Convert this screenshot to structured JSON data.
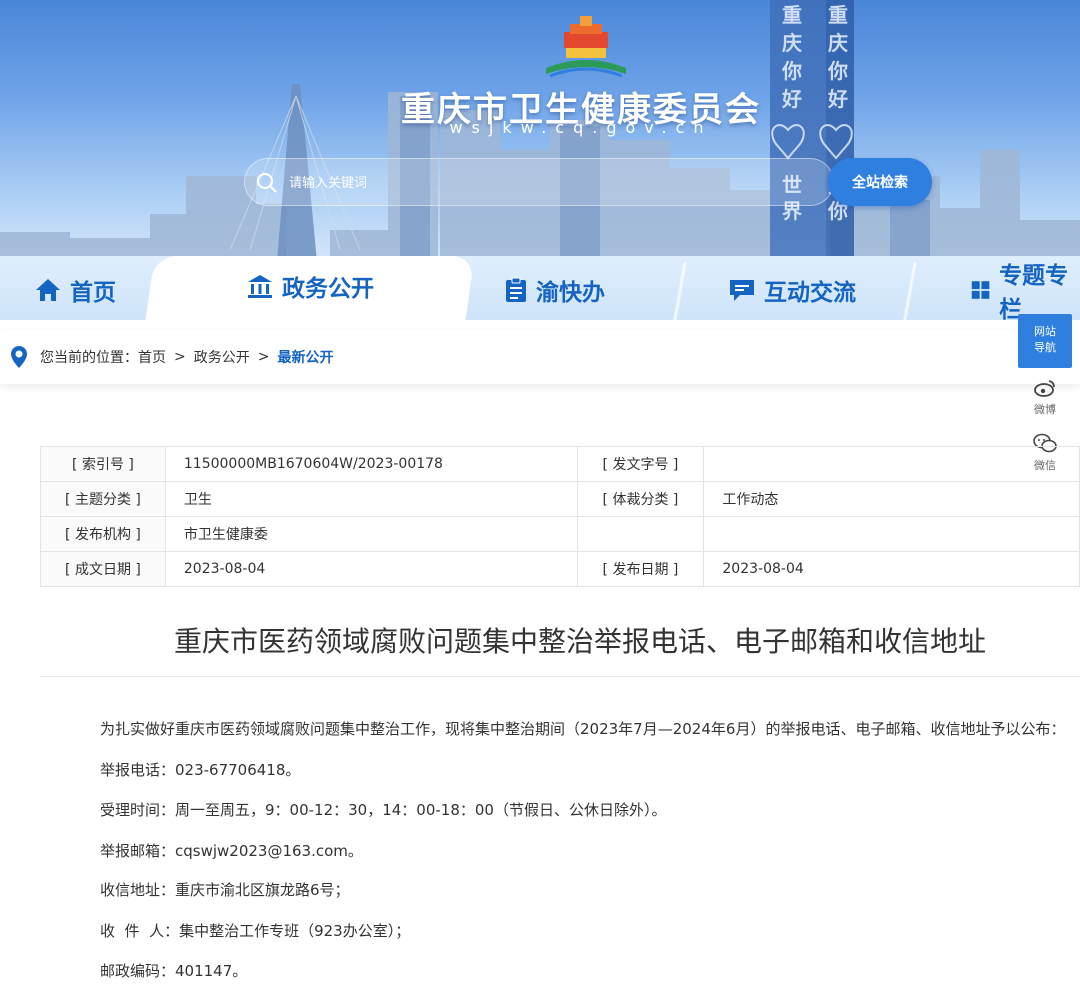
{
  "header": {
    "site_title": "重庆市卫生健康委员会",
    "site_domain": "wsjkw.cq.gov.cn",
    "billboard_text": [
      "重庆你好",
      "世界",
      "重庆你好",
      "拥你"
    ],
    "search": {
      "placeholder": "请输入关键词",
      "button_label": "全站检索"
    }
  },
  "nav": {
    "items": [
      {
        "label": "首页",
        "icon": "home-icon"
      },
      {
        "label": "政务公开",
        "icon": "government-building-icon",
        "active": true
      },
      {
        "label": "渝快办",
        "icon": "clipboard-icon"
      },
      {
        "label": "互动交流",
        "icon": "chat-icon"
      },
      {
        "label": "专题专栏",
        "icon": "grid-icon"
      }
    ]
  },
  "breadcrumb": {
    "prefix": "您当前的位置：",
    "items": [
      "首页",
      "政务公开",
      "最新公开"
    ],
    "separator": ">"
  },
  "float_bar": {
    "site_nav": [
      "网站",
      "导航"
    ],
    "weibo": "微博",
    "wechat": "微信"
  },
  "meta": {
    "rows": [
      {
        "k1": "[ 索引号 ]",
        "v1": "11500000MB1670604W/2023-00178",
        "k2": "[ 发文字号 ]",
        "v2": ""
      },
      {
        "k1": "[ 主题分类 ]",
        "v1": "卫生",
        "k2": "[ 体裁分类 ]",
        "v2": "工作动态"
      },
      {
        "k1": "[ 发布机构 ]",
        "v1": "市卫生健康委",
        "k2": "",
        "v2": ""
      },
      {
        "k1": "[ 成文日期 ]",
        "v1": "2023-08-04",
        "k2": "[ 发布日期 ]",
        "v2": "2023-08-04"
      }
    ]
  },
  "article": {
    "title": "重庆市医药领域腐败问题集中整治举报电话、电子邮箱和收信地址",
    "paragraphs": [
      "为扎实做好重庆市医药领域腐败问题集中整治工作，现将集中整治期间（2023年7月—2024年6月）的举报电话、电子邮箱、收信地址予以公布：",
      "举报电话：023-67706418。",
      "受理时间：周一至周五，9：00-12：30，14：00-18：00（节假日、公休日除外）。",
      "举报邮箱：cqswjw2023@163.com。",
      "收信地址：重庆市渝北区旗龙路6号；",
      "收  件  人：集中整治工作专班（923办公室）；",
      "邮政编码：401147。"
    ]
  },
  "colors": {
    "brand_blue": "#1664c2",
    "button_blue": "#2f7fe0"
  }
}
